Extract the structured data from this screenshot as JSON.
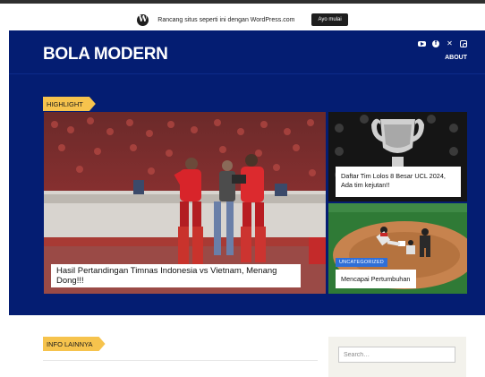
{
  "wp_banner": {
    "text": "Rancang situs seperti ini dengan WordPress.com",
    "button": "Ayo mulai"
  },
  "header": {
    "site_title": "BOLA MODERN",
    "nav_about": "ABOUT",
    "social_icons": [
      "youtube-icon",
      "facebook-icon",
      "x-icon",
      "instagram-icon"
    ],
    "background": "#041d72"
  },
  "highlight": {
    "tag": "HIGHLIGHT",
    "main_title": "Hasil Pertandingan Timnas Indonesia vs Vietnam, Menang Dong!!!",
    "side1_title": "Daftar Tim Lolos 8 Besar UCL 2024, Ada tim kejutan!!",
    "side2_category": "UNCATEGORIZED",
    "side2_title": "Mencapai Pertumbuhan"
  },
  "info": {
    "tag": "INFO LAINNYA"
  },
  "search": {
    "placeholder": "Search…"
  },
  "colors": {
    "accent_tag": "#f6c34d",
    "badge": "#2f6fd8"
  }
}
